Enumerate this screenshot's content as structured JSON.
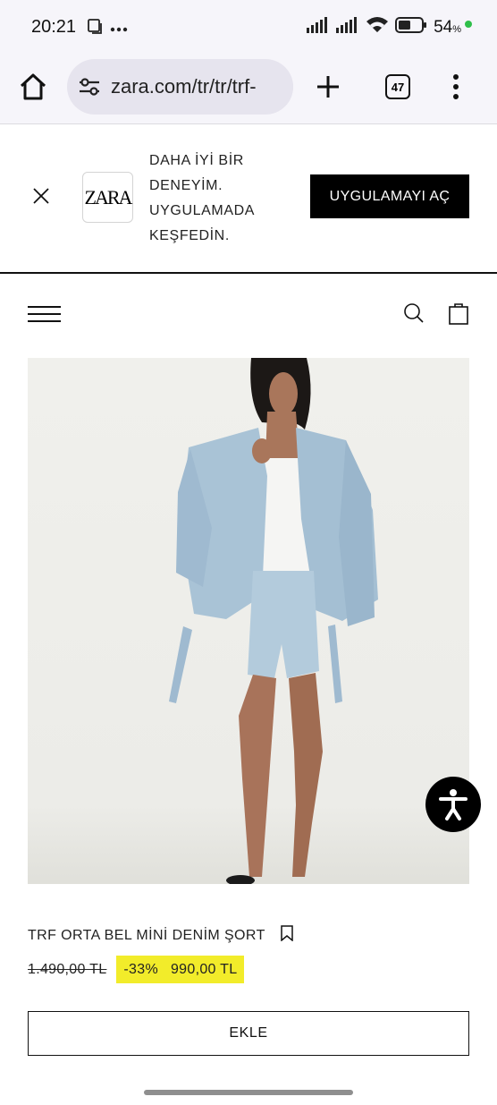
{
  "status_bar": {
    "time": "20:21",
    "icons_left": [
      "screenshot-icon",
      "more-dots-icon"
    ],
    "icons_right": [
      "signal-icon",
      "signal-icon",
      "wifi-icon",
      "battery-icon"
    ],
    "battery_percent": "54",
    "battery_unit": "%",
    "battery_level": 0.54,
    "charging_dot_color": "#2fbf4a"
  },
  "browser": {
    "url": "zara.com/tr/tr/trf-",
    "tab_count": "47",
    "icons": [
      "home-icon",
      "site-settings-icon",
      "new-tab-plus-icon",
      "tab-switcher-icon",
      "overflow-menu-icon"
    ]
  },
  "app_banner": {
    "logo_text": "ZARA",
    "message_lines": [
      "DAHA İYİ BİR",
      "DENEYİM.",
      "UYGULAMADA",
      "KEŞFEDİN."
    ],
    "open_app_label": "UYGULAMAYI AÇ"
  },
  "site_header": {
    "icons": [
      "hamburger-menu-icon",
      "search-icon",
      "shopping-bag-icon"
    ]
  },
  "product": {
    "image_alt": "Model wearing light-wash denim jacket over white tank top with frayed denim mini shorts",
    "name": "TRF ORTA BEL MİNİ DENİM ŞORT",
    "old_price": "1.490,00 TL",
    "discount": "-33%",
    "price": "990,00 TL",
    "add_label": "EKLE",
    "highlight_color": "#f2ec2a"
  },
  "accessibility": {
    "icon": "accessibility-person-icon"
  }
}
